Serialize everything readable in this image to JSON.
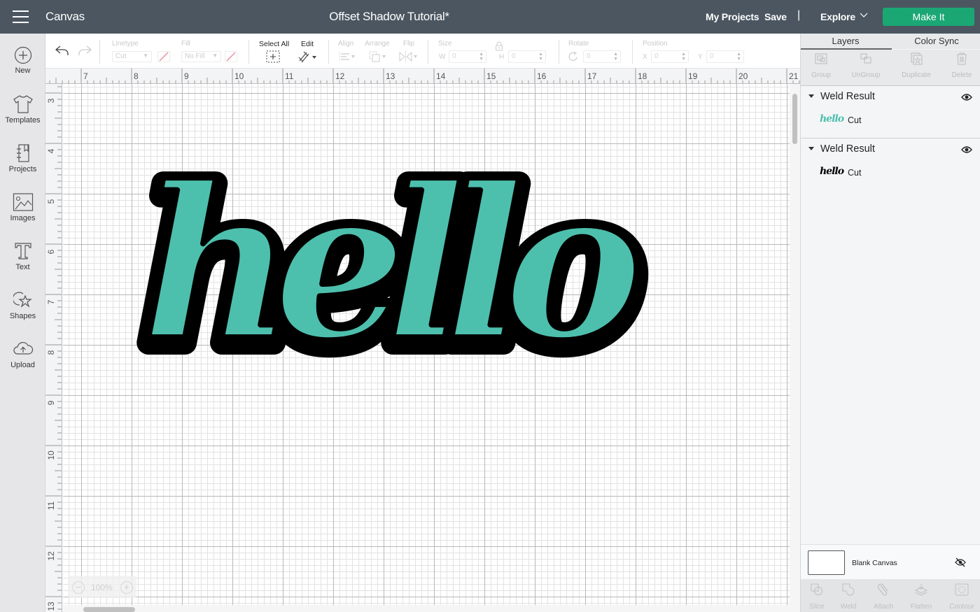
{
  "topbar": {
    "app_title": "Canvas",
    "doc_title": "Offset Shadow Tutorial*",
    "my_projects": "My Projects",
    "save": "Save",
    "separator": "|",
    "explore": "Explore",
    "make_it": "Make It",
    "colors": {
      "bar": "#4b5660",
      "make_it": "#1aa774"
    }
  },
  "sidebar": {
    "items": [
      {
        "label": "New",
        "icon": "plus-circle-icon"
      },
      {
        "label": "Templates",
        "icon": "tshirt-icon"
      },
      {
        "label": "Projects",
        "icon": "notebook-icon"
      },
      {
        "label": "Images",
        "icon": "image-icon"
      },
      {
        "label": "Text",
        "icon": "text-t-icon"
      },
      {
        "label": "Shapes",
        "icon": "shapes-icon"
      },
      {
        "label": "Upload",
        "icon": "cloud-upload-icon"
      }
    ]
  },
  "toolbar": {
    "undo": "undo-icon",
    "redo": "redo-icon",
    "linetype_label": "Linetype",
    "linetype_value": "Cut",
    "fill_label": "Fill",
    "fill_value": "No Fill",
    "select_all_label": "Select All",
    "edit_label": "Edit",
    "align_label": "Align",
    "arrange_label": "Arrange",
    "flip_label": "Flip",
    "size_label": "Size",
    "w_label": "W",
    "w_value": "0",
    "h_label": "H",
    "h_value": "0",
    "rotate_label": "Rotate",
    "rotate_value": "0",
    "position_label": "Position",
    "x_label": "X",
    "x_value": "0",
    "y_label": "Y",
    "y_value": "0"
  },
  "ruler": {
    "top": [
      "7",
      "8",
      "9",
      "10",
      "11",
      "12",
      "13",
      "14",
      "15",
      "16",
      "17",
      "18",
      "19",
      "20",
      "21"
    ],
    "left": [
      "3",
      "4",
      "5",
      "6",
      "7",
      "8",
      "9",
      "10",
      "11",
      "12",
      "13"
    ]
  },
  "canvas": {
    "design_text": "hello",
    "fill_color": "#4dbfad",
    "shadow_color": "#000000",
    "zoom_value": "100%"
  },
  "right_panel": {
    "tabs": [
      "Layers",
      "Color Sync"
    ],
    "actions": [
      "Group",
      "UnGroup",
      "Duplicate",
      "Delete"
    ],
    "layers": [
      {
        "title": "Weld Result",
        "thumb": "hello",
        "thumb_color": "#4dbfad",
        "operation": "Cut"
      },
      {
        "title": "Weld Result",
        "thumb": "hello",
        "thumb_color": "#000000",
        "operation": "Cut"
      }
    ],
    "blank_canvas": "Blank Canvas",
    "bottom_actions": [
      "Slice",
      "Weld",
      "Attach",
      "Flatten",
      "Contour"
    ]
  }
}
